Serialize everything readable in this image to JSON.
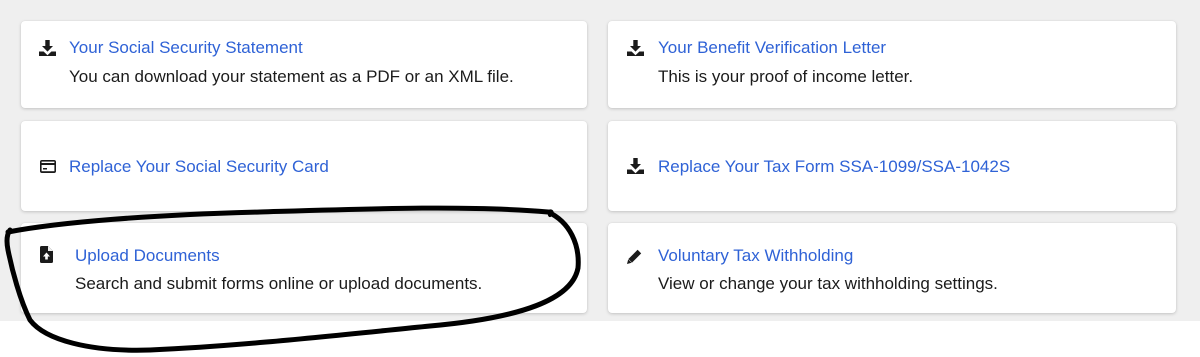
{
  "cards": [
    {
      "title": "Your Social Security Statement",
      "description": "You can download your statement as a PDF or an XML file.",
      "icon": "download-icon"
    },
    {
      "title": "Your Benefit Verification Letter",
      "description": "This is your proof of income letter.",
      "icon": "download-icon"
    },
    {
      "title": "Replace Your Social Security Card",
      "description": "",
      "icon": "card-icon"
    },
    {
      "title": "Replace Your Tax Form SSA-1099/SSA-1042S",
      "description": "",
      "icon": "download-icon"
    },
    {
      "title": "Upload Documents",
      "description": "Search and submit forms online or upload documents.",
      "icon": "file-upload-icon"
    },
    {
      "title": "Voluntary Tax Withholding",
      "description": "View or change your tax withholding settings.",
      "icon": "pencil-icon"
    }
  ],
  "colors": {
    "link": "#2f62d6",
    "text": "#1b1b1b",
    "panel": "#efefef",
    "card": "#ffffff",
    "annotation": "#000000"
  }
}
